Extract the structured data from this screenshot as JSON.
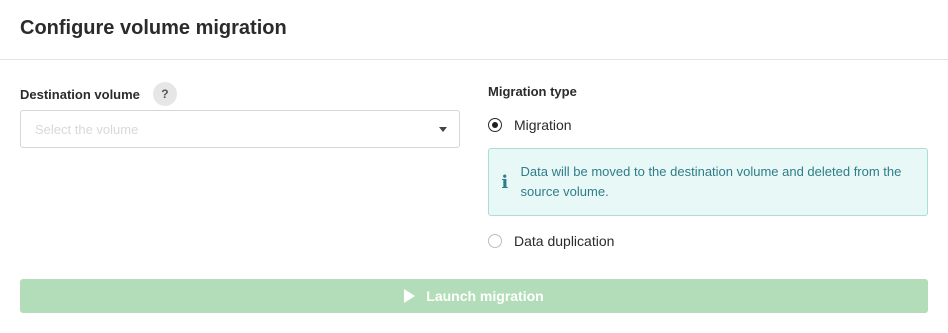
{
  "header": {
    "title": "Configure volume migration"
  },
  "destination": {
    "label": "Destination volume",
    "help_icon_text": "?",
    "select_placeholder": "Select the volume"
  },
  "migration_type": {
    "label": "Migration type",
    "options": [
      {
        "label": "Migration",
        "checked": true
      },
      {
        "label": "Data duplication",
        "checked": false
      }
    ],
    "info_icon_text": "i",
    "info_text": "Data will be moved to the destination volume and deleted from the source volume."
  },
  "launch_button": {
    "label": "Launch migration",
    "enabled": false
  },
  "colors": {
    "button_disabled": "#b3ddb8",
    "info_background": "#e8f8f6",
    "info_border": "#a9dfd6",
    "info_text": "#2f7d8a"
  }
}
